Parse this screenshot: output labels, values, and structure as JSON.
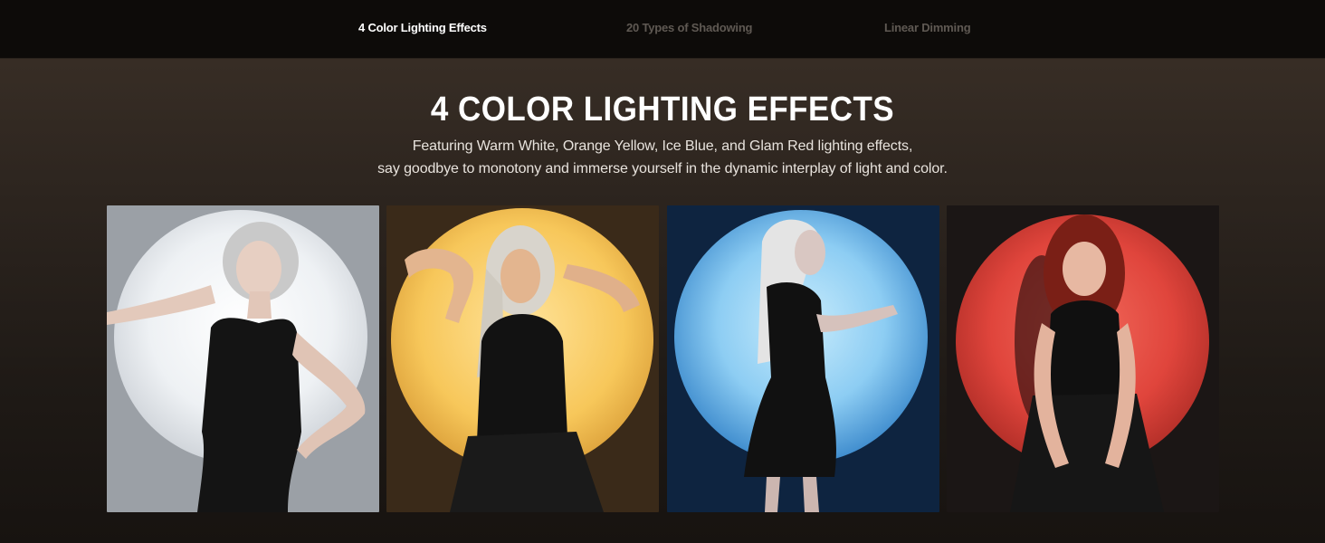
{
  "tabs": [
    {
      "label": "4 Color Lighting Effects",
      "active": true
    },
    {
      "label": "20 Types of Shadowing",
      "active": false
    },
    {
      "label": "Linear Dimming",
      "active": false
    }
  ],
  "section": {
    "title": "4 COLOR LIGHTING EFFECTS",
    "subtitle_line1": "Featuring Warm White, Orange Yellow, Ice Blue, and Glam Red lighting effects,",
    "subtitle_line2": "say goodbye to monotony and immerse yourself in the dynamic interplay of light and color."
  },
  "panels": [
    {
      "name": "warm-white",
      "bg": "#9ba0a6",
      "circle": "#f4f6f8",
      "glow": "#ffffff",
      "hair": "#c9c9c9",
      "skin": "#e7cfc2"
    },
    {
      "name": "orange-yellow",
      "bg": "#3a2a19",
      "circle": "#f7c75a",
      "glow": "#ffe39a",
      "hair": "#d8d4cc",
      "skin": "#e3b58f"
    },
    {
      "name": "ice-blue",
      "bg": "#0e2440",
      "circle": "#4aa8e6",
      "glow": "#bfe6fb",
      "hair": "#e4e4e4",
      "skin": "#d9c7c2"
    },
    {
      "name": "glam-red",
      "bg": "#1b1615",
      "circle": "#e0453c",
      "glow": "#f26a5c",
      "hair": "#7a1f16",
      "skin": "#e7b8a2"
    }
  ]
}
